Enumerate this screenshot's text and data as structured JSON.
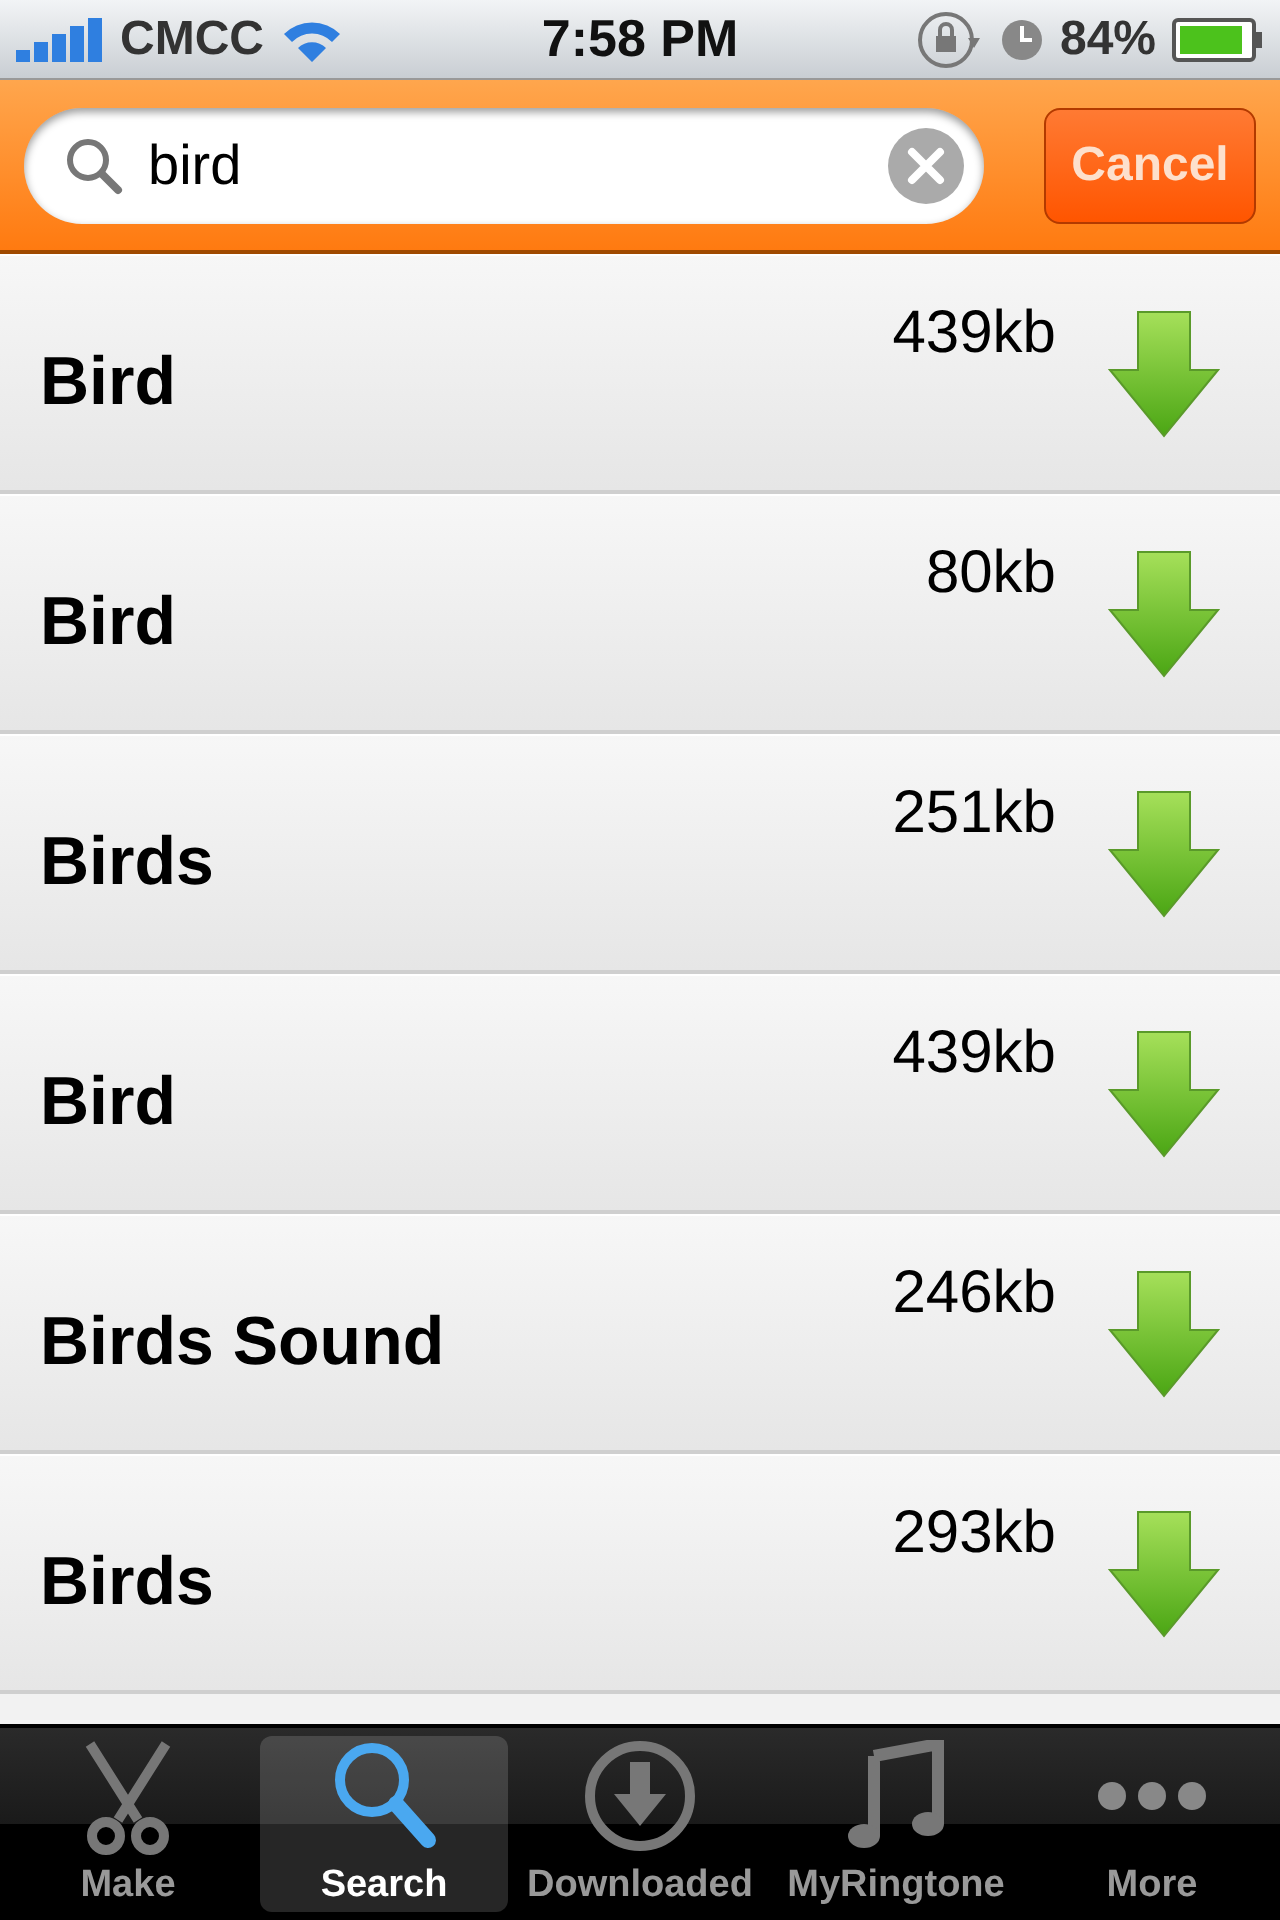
{
  "status_bar": {
    "carrier": "CMCC",
    "time": "7:58 PM",
    "battery": "84%"
  },
  "search": {
    "value": "bird",
    "cancel": "Cancel"
  },
  "results": [
    {
      "title": "Bird",
      "size": "439kb"
    },
    {
      "title": "Bird",
      "size": "80kb"
    },
    {
      "title": "Birds",
      "size": "251kb"
    },
    {
      "title": "Bird",
      "size": "439kb"
    },
    {
      "title": "Birds Sound",
      "size": "246kb"
    },
    {
      "title": "Birds",
      "size": "293kb"
    }
  ],
  "tabs": [
    {
      "label": "Make",
      "selected": false
    },
    {
      "label": "Search",
      "selected": true
    },
    {
      "label": "Downloaded",
      "selected": false
    },
    {
      "label": "MyRingtone",
      "selected": false
    },
    {
      "label": "More",
      "selected": false
    }
  ]
}
